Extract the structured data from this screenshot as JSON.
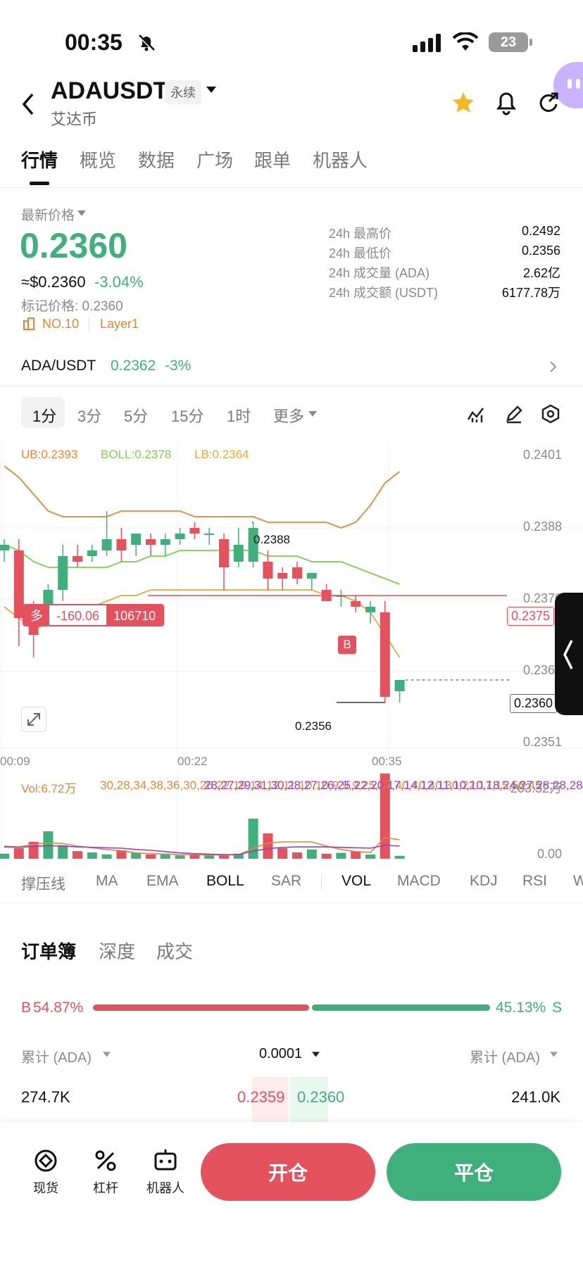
{
  "status_bar": {
    "time": "00:35",
    "battery": "23"
  },
  "header": {
    "symbol": "ADAUSDT",
    "contract_badge": "永续",
    "subtitle": "艾达币"
  },
  "tabs": [
    "行情",
    "概览",
    "数据",
    "广场",
    "跟单",
    "机器人"
  ],
  "price": {
    "label": "最新价格",
    "last": "0.2360",
    "usd": "≈$0.2360",
    "change": "-3.04%",
    "mark": "标记价格: 0.2360",
    "rank": "NO.10",
    "sector": "Layer1"
  },
  "stats": [
    {
      "label": "24h 最高价",
      "value": "0.2492"
    },
    {
      "label": "24h 最低价",
      "value": "0.2356"
    },
    {
      "label": "24h 成交量 (ADA)",
      "value": "2.62亿"
    },
    {
      "label": "24h 成交额 (USDT)",
      "value": "6177.78万"
    }
  ],
  "spot_link": {
    "pair": "ADA/USDT",
    "price": "0.2362",
    "change": "-3%"
  },
  "timeframes": [
    "1分",
    "3分",
    "5分",
    "15分",
    "1时",
    "更多"
  ],
  "chart": {
    "boll": {
      "ub": "UB:0.2393",
      "mid": "BOLL:0.2378",
      "lb": "LB:0.2364"
    },
    "y_ticks": [
      "0.2401",
      "0.2388",
      "0.2376",
      "0.2364",
      "0.2351"
    ],
    "x_ticks": [
      "00:09",
      "00:22",
      "00:35"
    ],
    "high_marker": "0.2388",
    "low_marker": "0.2356",
    "position": {
      "side": "多",
      "pnl": "-160.06",
      "qty": "106710",
      "entry_tag": "0.2375"
    },
    "last_tag": "0.2360",
    "trade_marker": "B",
    "colors": {
      "up": "#3fb07b",
      "down": "#e4525e",
      "ub": "#e0883a",
      "mid": "#7ccf4e",
      "lb": "#e8a93a"
    }
  },
  "chart_data": {
    "type": "candlestick",
    "y_axis": [
      0.2351,
      0.2401
    ],
    "candles": [
      {
        "o": 0.2383,
        "h": 0.2385,
        "l": 0.2381,
        "c": 0.2384
      },
      {
        "o": 0.2383,
        "h": 0.2385,
        "l": 0.2366,
        "c": 0.2371
      },
      {
        "o": 0.2371,
        "h": 0.2374,
        "l": 0.2364,
        "c": 0.2368
      },
      {
        "o": 0.2372,
        "h": 0.2377,
        "l": 0.2371,
        "c": 0.2376
      },
      {
        "o": 0.2376,
        "h": 0.2384,
        "l": 0.2374,
        "c": 0.2382
      },
      {
        "o": 0.2382,
        "h": 0.2384,
        "l": 0.238,
        "c": 0.2381
      },
      {
        "o": 0.2382,
        "h": 0.2384,
        "l": 0.2381,
        "c": 0.2383
      },
      {
        "o": 0.2383,
        "h": 0.239,
        "l": 0.2382,
        "c": 0.2385
      },
      {
        "o": 0.2385,
        "h": 0.2387,
        "l": 0.2381,
        "c": 0.2383
      },
      {
        "o": 0.2384,
        "h": 0.2386,
        "l": 0.2382,
        "c": 0.2386
      },
      {
        "o": 0.2385,
        "h": 0.2386,
        "l": 0.2382,
        "c": 0.2384
      },
      {
        "o": 0.2384,
        "h": 0.2386,
        "l": 0.2382,
        "c": 0.2385
      },
      {
        "o": 0.2385,
        "h": 0.2387,
        "l": 0.2384,
        "c": 0.2386
      },
      {
        "o": 0.2387,
        "h": 0.2388,
        "l": 0.2385,
        "c": 0.2386
      },
      {
        "o": 0.2386,
        "h": 0.2387,
        "l": 0.2384,
        "c": 0.2386
      },
      {
        "o": 0.2385,
        "h": 0.2386,
        "l": 0.2376,
        "c": 0.238
      },
      {
        "o": 0.2381,
        "h": 0.2387,
        "l": 0.238,
        "c": 0.2384
      },
      {
        "o": 0.2381,
        "h": 0.2388,
        "l": 0.238,
        "c": 0.2387
      },
      {
        "o": 0.2381,
        "h": 0.2383,
        "l": 0.2376,
        "c": 0.2378
      },
      {
        "o": 0.2379,
        "h": 0.238,
        "l": 0.2376,
        "c": 0.2378
      },
      {
        "o": 0.238,
        "h": 0.2381,
        "l": 0.2377,
        "c": 0.2378
      },
      {
        "o": 0.2378,
        "h": 0.2379,
        "l": 0.2376,
        "c": 0.2379
      },
      {
        "o": 0.2376,
        "h": 0.2377,
        "l": 0.2374,
        "c": 0.2374
      },
      {
        "o": 0.2375,
        "h": 0.2376,
        "l": 0.2373,
        "c": 0.2375
      },
      {
        "o": 0.2374,
        "h": 0.2375,
        "l": 0.2372,
        "c": 0.2373
      },
      {
        "o": 0.2372,
        "h": 0.2374,
        "l": 0.237,
        "c": 0.2373
      },
      {
        "o": 0.2372,
        "h": 0.2374,
        "l": 0.2356,
        "c": 0.2357
      },
      {
        "o": 0.2358,
        "h": 0.2359,
        "l": 0.2356,
        "c": 0.236
      }
    ],
    "boll_upper": [
      0.2398,
      0.2396,
      0.2393,
      0.239,
      0.2389,
      0.2389,
      0.2389,
      0.2389,
      0.239,
      0.239,
      0.239,
      0.239,
      0.239,
      0.2389,
      0.2389,
      0.2389,
      0.2389,
      0.2389,
      0.2388,
      0.2388,
      0.2388,
      0.2388,
      0.2388,
      0.2387,
      0.2388,
      0.2391,
      0.2395,
      0.2397
    ],
    "boll_mid": [
      0.2384,
      0.2383,
      0.2381,
      0.238,
      0.238,
      0.238,
      0.238,
      0.238,
      0.2381,
      0.2381,
      0.2382,
      0.2382,
      0.2383,
      0.2383,
      0.2383,
      0.2383,
      0.2383,
      0.2383,
      0.2382,
      0.2382,
      0.2382,
      0.2381,
      0.2381,
      0.2381,
      0.238,
      0.2379,
      0.2378,
      0.2377
    ],
    "boll_lower": [
      0.2373,
      0.2371,
      0.2369,
      0.237,
      0.2371,
      0.2372,
      0.2373,
      0.2374,
      0.2375,
      0.2375,
      0.2376,
      0.2376,
      0.2376,
      0.2376,
      0.2376,
      0.2376,
      0.2376,
      0.2376,
      0.2376,
      0.2376,
      0.2376,
      0.2376,
      0.2375,
      0.2375,
      0.2374,
      0.2372,
      0.2368,
      0.2364
    ],
    "volume": {
      "label": "Vol:6.72万",
      "ma5": [
        30,
        28,
        34,
        38,
        36,
        30,
        26,
        22,
        19,
        14,
        12,
        11,
        10,
        10,
        9,
        9,
        9,
        25,
        37,
        40,
        40,
        40,
        30,
        22,
        17,
        15,
        50,
        45
      ],
      "ma10": [
        28,
        27,
        29,
        31,
        30,
        28,
        27,
        26,
        25,
        22,
        20,
        17,
        14,
        12,
        11,
        10,
        10,
        18,
        24,
        27,
        28,
        28,
        28,
        27,
        26,
        25,
        32,
        30
      ],
      "y_ticks": [
        "203.32万",
        "0.00"
      ],
      "max": 203.32,
      "values": [
        12,
        25,
        40,
        65,
        32,
        18,
        15,
        10,
        20,
        14,
        10,
        12,
        8,
        10,
        8,
        10,
        12,
        95,
        60,
        25,
        15,
        22,
        12,
        14,
        18,
        10,
        202,
        7
      ]
    }
  },
  "indicators": [
    "撑压线",
    "MA",
    "EMA",
    "BOLL",
    "SAR",
    "VOL",
    "MACD",
    "KDJ",
    "RSI",
    "W"
  ],
  "orderbook": {
    "tabs": [
      "订单簿",
      "深度",
      "成交"
    ],
    "buy_pct": "54.87%",
    "sell_pct": "45.13%",
    "buy_ratio": 0.5487,
    "buy_prefix": "B",
    "sell_suffix": "S",
    "col_left": "累计 (ADA)",
    "precision": "0.0001",
    "col_right": "累计 (ADA)",
    "bid_size": "274.7K",
    "bid_price": "0.2359",
    "ask_price": "0.2360",
    "ask_size": "241.0K"
  },
  "bottom_nav": {
    "spot": "现货",
    "leverage": "杠杆",
    "bots": "机器人",
    "open": "开仓",
    "close": "平仓"
  }
}
